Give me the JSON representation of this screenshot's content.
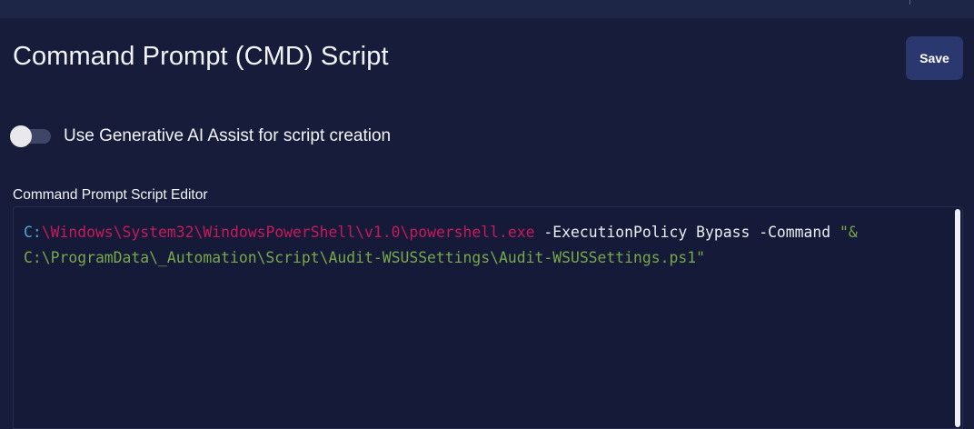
{
  "header": {
    "title": "Command Prompt (CMD) Script",
    "save_label": "Save"
  },
  "ai_assist": {
    "label": "Use Generative AI Assist for script creation",
    "enabled": false
  },
  "editor": {
    "label": "Command Prompt Script Editor",
    "line1": {
      "drive": "C:",
      "path": "\\Windows\\System32\\WindowsPowerShell\\v1.0\\powershell.exe",
      "args": " -ExecutionPolicy Bypass -Command ",
      "string_start": "\"&"
    },
    "line2": {
      "string_rest": "C:\\ProgramData\\_Automation\\Script\\Audit-WSUSSettings\\Audit-WSUSSettings.ps1\""
    }
  },
  "colors": {
    "background": "#161c3a",
    "save_button": "#2b3870",
    "syntax_drive": "#4aa4d2",
    "syntax_path": "#c9195b",
    "syntax_string": "#78a84a"
  }
}
